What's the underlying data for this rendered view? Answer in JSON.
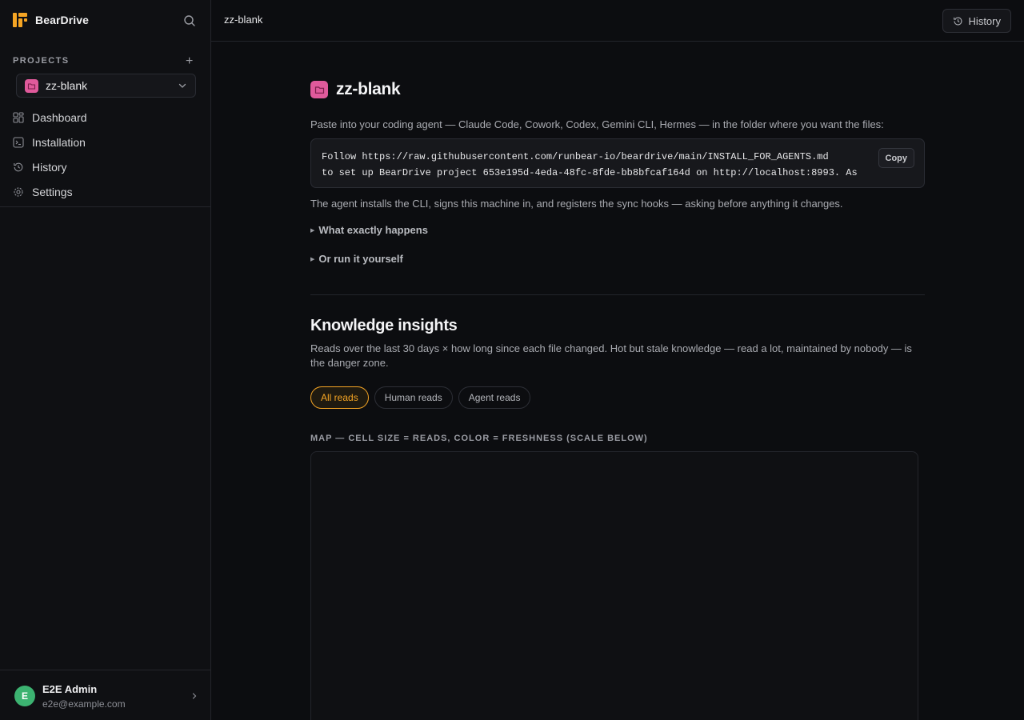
{
  "sidebar": {
    "brand": "BearDrive",
    "projects_label": "PROJECTS",
    "add_symbol": "+",
    "current_project": "zz-blank",
    "nav": [
      "Dashboard",
      "Installation",
      "History",
      "Settings"
    ],
    "user": {
      "initial": "E",
      "name": "E2E Admin",
      "email": "e2e@example.com"
    }
  },
  "topbar": {
    "breadcrumb": "zz-blank",
    "history_label": "History"
  },
  "main": {
    "title": "zz-blank",
    "paste_instructions": "Paste into your coding agent — Claude Code, Cowork, Codex, Gemini CLI, Hermes — in the folder where you want the files:",
    "code_line1": "Follow https://raw.githubusercontent.com/runbear-io/beardrive/main/INSTALL_FOR_AGENTS.md",
    "code_line2": "to set up BearDrive project 653e195d-4eda-48fc-8fde-bb8bfcaf164d on http://localhost:8993. As",
    "copy_label": "Copy",
    "agent_info": "The agent installs the CLI, signs this machine in, and registers the sync hooks — asking before anything it changes.",
    "details": [
      "What exactly happens",
      "Or run it yourself"
    ],
    "insights_title": "Knowledge insights",
    "insights_desc": "Reads over the last 30 days × how long since each file changed. Hot but stale knowledge — read a lot, maintained by nobody — is the danger zone.",
    "tabs": [
      "All reads",
      "Human reads",
      "Agent reads"
    ],
    "active_tab": "All reads",
    "map_label": "MAP — CELL SIZE = READS, COLOR = FRESHNESS (SCALE BELOW)"
  },
  "colors": {
    "accent": "#f5a524",
    "project": "#e05a9b",
    "avatar": "#3cb371"
  }
}
